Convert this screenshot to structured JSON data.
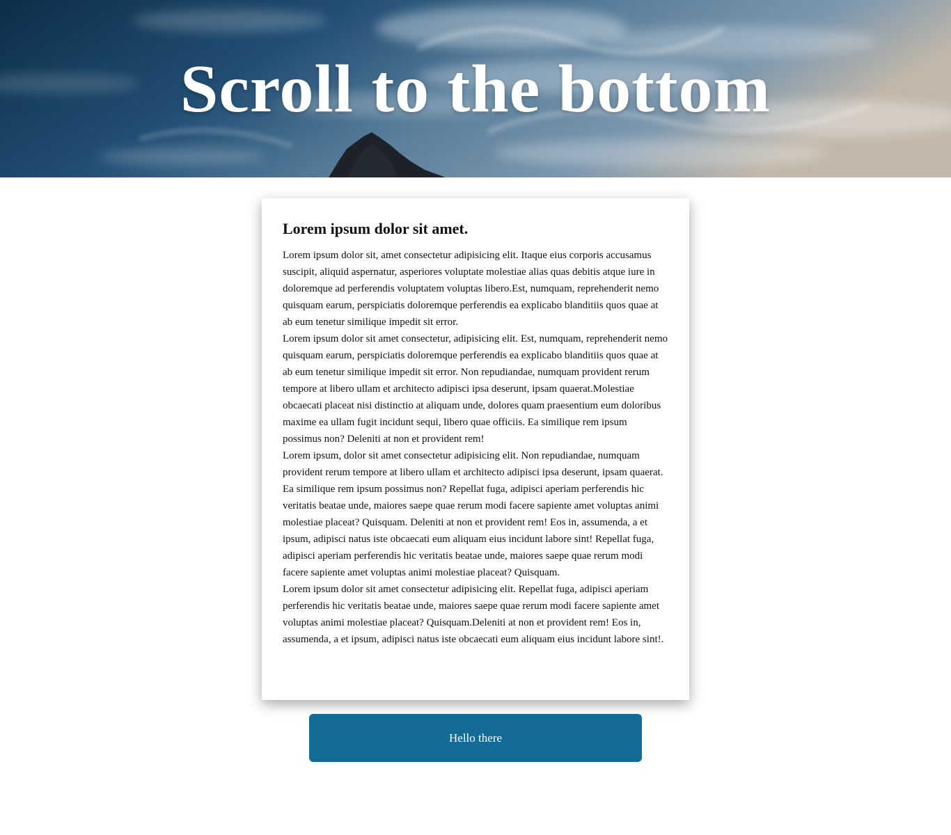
{
  "hero": {
    "title": "Scroll to the bottom",
    "image": "sky-clouds-mountain-peak",
    "colors": {
      "sky_dark": "#0f3350",
      "sky_light": "#b3b8bd",
      "peak": "#1c2228"
    }
  },
  "card": {
    "title": "Lorem ipsum dolor sit amet.",
    "paragraphs": [
      "Lorem ipsum dolor sit, amet consectetur adipisicing elit. Itaque eius corporis accusamus suscipit, aliquid aspernatur, asperiores voluptate molestiae alias quas debitis atque iure in doloremque ad perferendis voluptatem voluptas libero.Est, numquam, reprehenderit nemo quisquam earum, perspiciatis doloremque perferendis ea explicabo blanditiis quos quae at ab eum tenetur similique impedit sit error.",
      "Lorem ipsum dolor sit amet consectetur, adipisicing elit. Est, numquam, reprehenderit nemo quisquam earum, perspiciatis doloremque perferendis ea explicabo blanditiis quos quae at ab eum tenetur similique impedit sit error. Non repudiandae, numquam provident rerum tempore at libero ullam et architecto adipisci ipsa deserunt, ipsam quaerat.Molestiae obcaecati placeat nisi distinctio at aliquam unde, dolores quam praesentium eum doloribus maxime ea ullam fugit incidunt sequi, libero quae officiis. Ea similique rem ipsum possimus non? Deleniti at non et provident rem!",
      "Lorem ipsum, dolor sit amet consectetur adipisicing elit. Non repudiandae, numquam provident rerum tempore at libero ullam et architecto adipisci ipsa deserunt, ipsam quaerat. Ea similique rem ipsum possimus non? Repellat fuga, adipisci aperiam perferendis hic veritatis beatae unde, maiores saepe quae rerum modi facere sapiente amet voluptas animi molestiae placeat? Quisquam. Deleniti at non et provident rem! Eos in, assumenda, a et ipsum, adipisci natus iste obcaecati eum aliquam eius incidunt labore sint! Repellat fuga, adipisci aperiam perferendis hic veritatis beatae unde, maiores saepe quae rerum modi facere sapiente amet voluptas animi molestiae placeat? Quisquam.",
      "Lorem ipsum dolor sit amet consectetur adipisicing elit. Repellat fuga, adipisci aperiam perferendis hic veritatis beatae unde, maiores saepe quae rerum modi facere sapiente amet voluptas animi molestiae placeat? Quisquam.Deleniti at non et provident rem! Eos in, assumenda, a et ipsum, adipisci natus iste obcaecati eum aliquam eius incidunt labore sint!."
    ]
  },
  "button": {
    "label": "Hello there",
    "color": "#146c96"
  }
}
